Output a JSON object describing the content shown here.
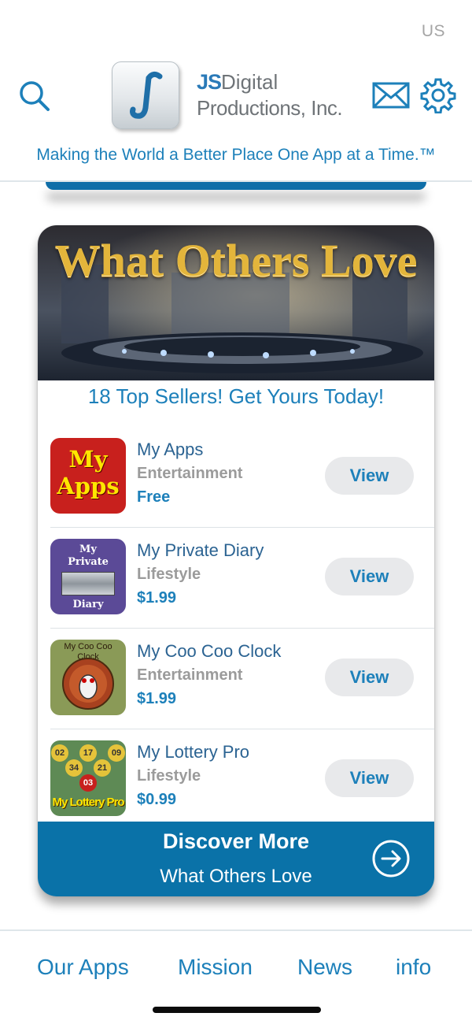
{
  "status": {
    "region": "US"
  },
  "header": {
    "company_js": "JS",
    "company_digital": "Digital",
    "company_line2": "Productions, Inc.",
    "tagline": "Making the World a Better Place One App at a Time.™"
  },
  "banner": {
    "title": "What Others Love"
  },
  "card": {
    "subtitle": "18 Top Sellers!  Get Yours Today!",
    "apps": [
      {
        "name": "My Apps",
        "category": "Entertainment",
        "price": "Free",
        "view_label": "View",
        "icon_text": [
          "My",
          "Apps"
        ]
      },
      {
        "name": "My Private Diary",
        "category": "Lifestyle",
        "price": "$1.99",
        "view_label": "View",
        "icon_text": [
          "My",
          "Private",
          "Diary"
        ]
      },
      {
        "name": "My Coo Coo Clock",
        "category": "Entertainment",
        "price": "$1.99",
        "view_label": "View",
        "icon_text": [
          "My Coo Coo",
          "Clock"
        ]
      },
      {
        "name": "My Lottery Pro",
        "category": "Lifestyle",
        "price": "$0.99",
        "view_label": "View",
        "icon_text": [
          "02",
          "17",
          "09",
          "34",
          "21",
          "03",
          "My Lottery Pro"
        ]
      }
    ],
    "discover_title": "Discover More",
    "discover_sub": "What Others Love"
  },
  "tabs": [
    "Our Apps",
    "Mission",
    "News",
    "info"
  ],
  "colors": {
    "accent": "#1d80ba",
    "discover_bg": "#0a72a8",
    "view_bg": "#e8e9eb"
  }
}
